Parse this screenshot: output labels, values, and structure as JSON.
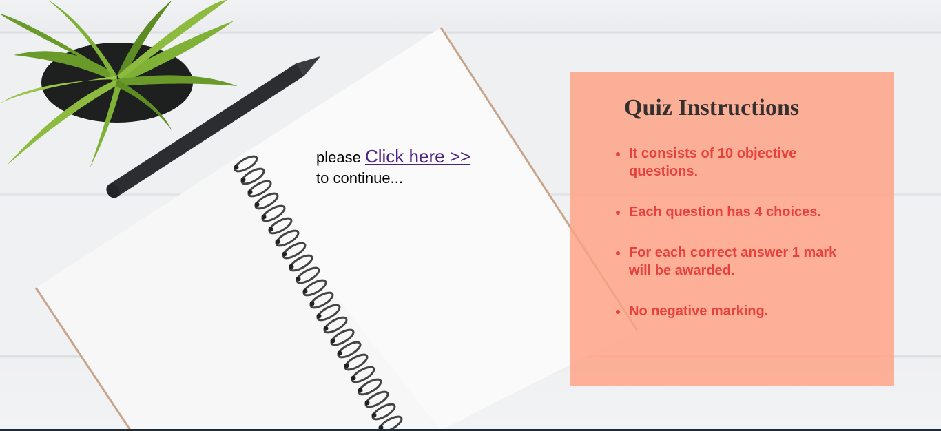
{
  "continue": {
    "prefix": "please",
    "link_label": "Click here >>",
    "suffix": "to continue..."
  },
  "instructions": {
    "title": "Quiz Instructions",
    "items": [
      "It consists of 10 objective questions.",
      "Each question has 4 choices.",
      "For each correct answer 1 mark will be awarded.",
      "No negative marking."
    ]
  },
  "colors": {
    "panel": "#ffa082",
    "item_text": "#e8403d",
    "title_text": "#33302f",
    "link": "#4b2383"
  }
}
